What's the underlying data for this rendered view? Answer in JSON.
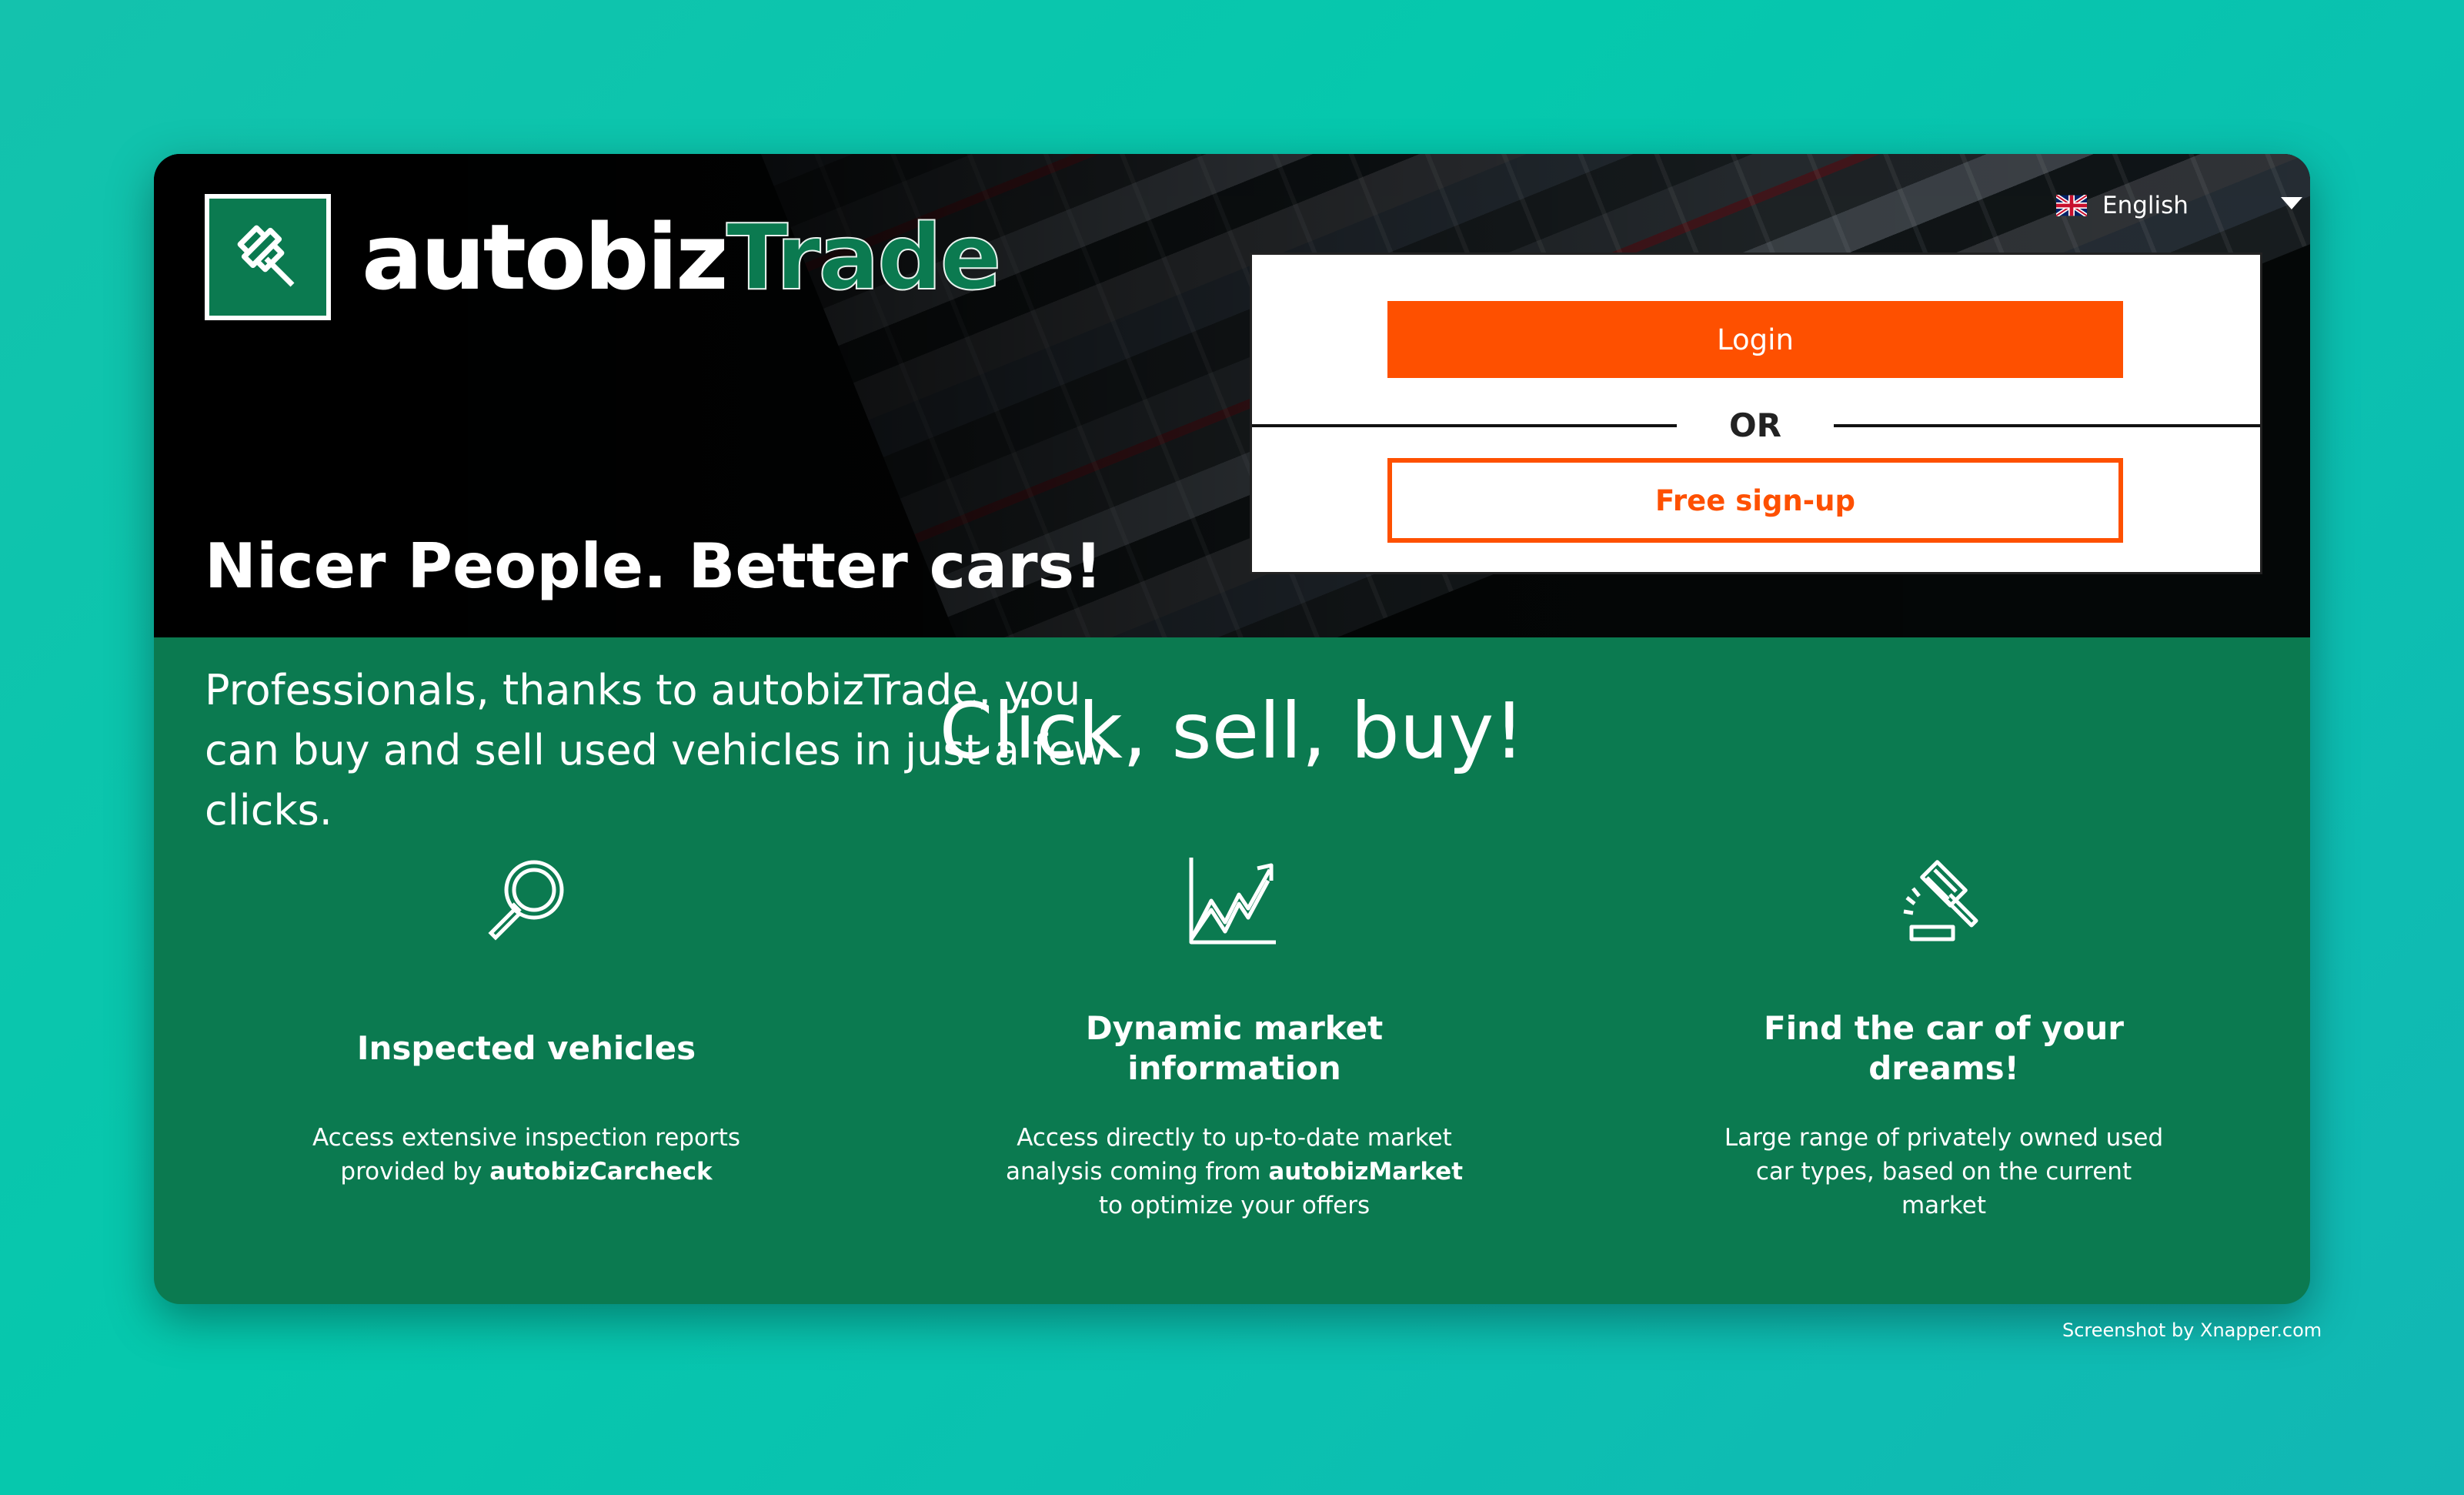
{
  "brand": {
    "name_part1": "autobiz",
    "name_part2": "Trade"
  },
  "language": {
    "selected": "English"
  },
  "hero": {
    "headline": "Nicer People. Better cars!",
    "subline": "Professionals, thanks to autobizTrade, you can buy and sell used vehicles in just a few clicks."
  },
  "auth": {
    "login_label": "Login",
    "or_label": "OR",
    "signup_label": "Free sign-up"
  },
  "features_section": {
    "title": "Click, sell, buy!",
    "items": [
      {
        "title": "Inspected vehicles",
        "desc_before": "Access extensive inspection reports provided by ",
        "desc_bold": "autobizCarcheck",
        "desc_after": "",
        "icon": "magnifier-icon"
      },
      {
        "title": "Dynamic market information",
        "desc_before": "Access directly to up-to-date market analysis coming from ",
        "desc_bold": "autobizMarket",
        "desc_after": " to optimize your offers",
        "icon": "trend-chart-icon"
      },
      {
        "title": "Find the car of your dreams!",
        "desc_before": "Large range of privately owned used car types, based on the current market",
        "desc_bold": "",
        "desc_after": "",
        "icon": "gavel-icon"
      }
    ]
  },
  "colors": {
    "brand_green": "#0b7a50",
    "accent_orange": "#fe5000",
    "background_teal": "#05c8ad"
  },
  "credit": "Screenshot by Xnapper.com"
}
